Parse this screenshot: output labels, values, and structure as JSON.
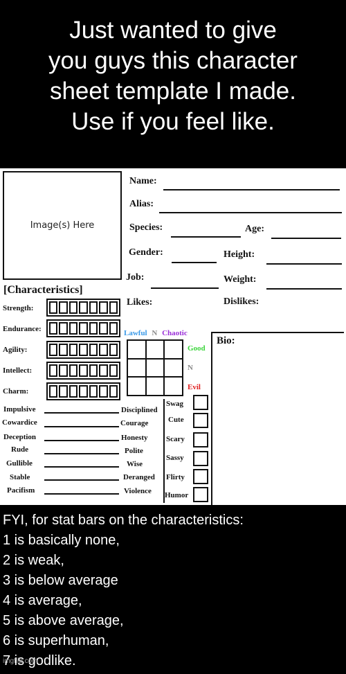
{
  "top_caption": {
    "lines": [
      "Just wanted to give",
      "you guys this character",
      "sheet template I made.",
      "Use if you feel like."
    ]
  },
  "sheet": {
    "image_placeholder": "Image(s) Here",
    "fields": {
      "name": "Name:",
      "alias": "Alias:",
      "species": "Species:",
      "age": "Age:",
      "gender": "Gender:",
      "height": "Height:",
      "job": "Job:",
      "weight": "Weight:",
      "likes": "Likes:",
      "dislikes": "Dislikes:"
    },
    "characteristics": {
      "title": "[Characteristics]",
      "scale_max": 7,
      "stats": [
        {
          "label": "Strength:"
        },
        {
          "label": "Endurance:"
        },
        {
          "label": "Agility:"
        },
        {
          "label": "Intellect:"
        },
        {
          "label": "Charm:"
        }
      ]
    },
    "alignment": {
      "columns": [
        {
          "label": "Lawful",
          "color": "#3a9ae8"
        },
        {
          "label": "N",
          "color": "#8a8a8a"
        },
        {
          "label": "Chaotic",
          "color": "#9b30d9"
        }
      ],
      "rows": [
        {
          "label": "Good",
          "color": "#3ad43a"
        },
        {
          "label": "N",
          "color": "#8a8a8a"
        },
        {
          "label": "Evil",
          "color": "#e02020"
        }
      ]
    },
    "bio_label": "Bio:",
    "traits": [
      {
        "left": "Impulsive",
        "right": "Disciplined"
      },
      {
        "left": "Cowardice",
        "right": "Courage"
      },
      {
        "left": "Deception",
        "right": "Honesty"
      },
      {
        "left": "Rude",
        "right": "Polite"
      },
      {
        "left": "Gullible",
        "right": "Wise"
      },
      {
        "left": "Stable",
        "right": "Deranged"
      },
      {
        "left": "Pacifism",
        "right": "Violence"
      }
    ],
    "moods": [
      "Swag",
      "Cute",
      "Scary",
      "Sassy",
      "Flirty",
      "Humor"
    ]
  },
  "bottom_caption": {
    "lines": [
      "FYI, for stat bars on the characteristics:",
      "1 is basically none,",
      "2 is weak,",
      "3 is below average",
      "4 is average,",
      "5 is above average,",
      "6 is superhuman,",
      "7 is godlike."
    ],
    "watermark": "imgflip.com"
  }
}
